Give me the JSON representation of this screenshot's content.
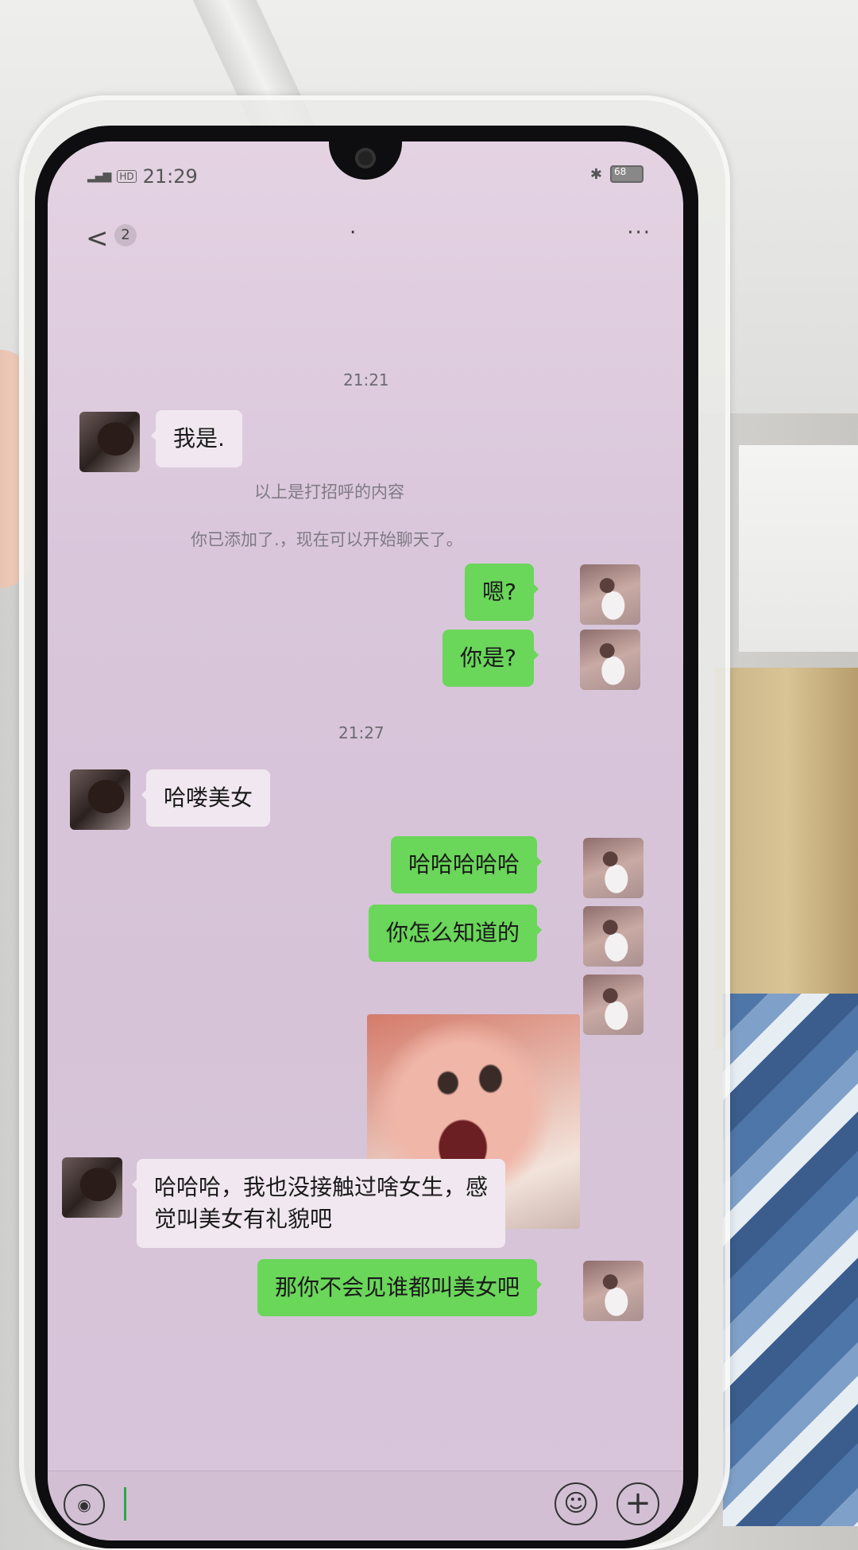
{
  "status_bar": {
    "time": "21:29",
    "network": "HD",
    "battery": "68"
  },
  "header": {
    "back_label": "<",
    "unread_count": "2",
    "title": "·",
    "more_label": "···"
  },
  "timestamps": [
    "21:21",
    "21:27"
  ],
  "system_messages": [
    "以上是打招呼的内容",
    "你已添加了.，现在可以开始聊天了。"
  ],
  "messages": [
    {
      "side": "left",
      "text": "我是."
    },
    {
      "side": "right",
      "text": "嗯?"
    },
    {
      "side": "right",
      "text": "你是?"
    },
    {
      "side": "left",
      "text": "哈喽美女"
    },
    {
      "side": "right",
      "text": "哈哈哈哈哈"
    },
    {
      "side": "right",
      "text": "你怎么知道的"
    },
    {
      "side": "right",
      "type": "image",
      "text": ""
    },
    {
      "side": "left",
      "text": "哈哈哈，我也没接触过啥女生，感觉叫美女有礼貌吧"
    },
    {
      "side": "right",
      "text": "那你不会见谁都叫美女吧"
    }
  ],
  "input_bar": {
    "voice_icon": "voice-icon",
    "emoji_icon": "emoji-icon",
    "plus_icon": "plus-icon",
    "input_value": ""
  },
  "colors": {
    "sent_bubble": "#6ad65a",
    "received_bubble": "#f1e7f0",
    "screen_tint": "#d9c6db"
  }
}
